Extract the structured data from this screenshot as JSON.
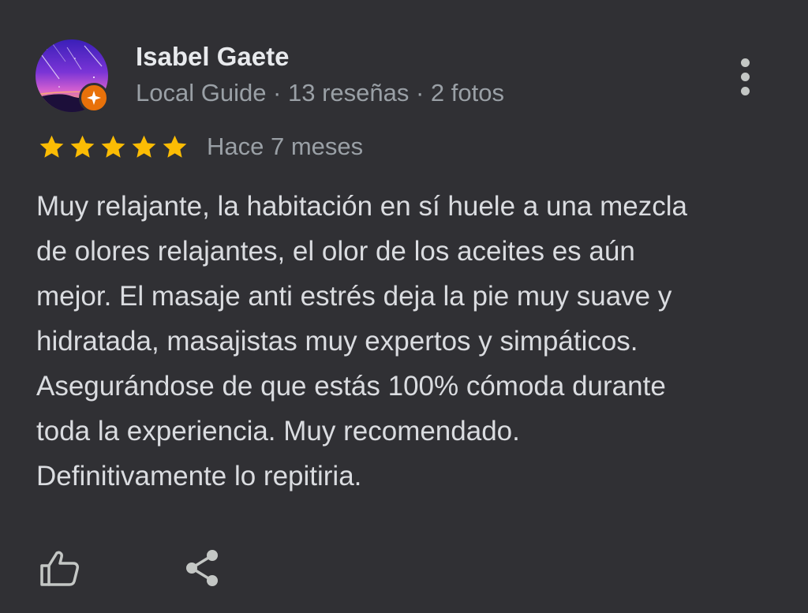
{
  "author": {
    "name": "Isabel Gaete",
    "meta": "Local Guide · 13 reseñas · 2 fotos",
    "avatar_icon": "avatar-purple-sky",
    "badge_icon": "local-guide-star-icon",
    "badge_color": "#e8710a"
  },
  "rating": {
    "stars": 5,
    "max_stars": 5,
    "star_color": "#fbbc04",
    "date": "Hace 7 meses"
  },
  "review": {
    "lines": [
      "Muy relajante, la habitación en sí huele a una mezcla",
      "de olores relajantes, el olor de los aceites es aún",
      "mejor. El masaje anti estrés deja la pie muy suave y",
      "hidratada, masajistas muy expertos y simpáticos.",
      "Asegurándose de que estás 100% cómoda durante",
      "toda la experiencia. Muy recomendado.",
      "Definitivamente lo repitiria."
    ]
  },
  "actions": {
    "like_icon": "thumbs-up-icon",
    "share_icon": "share-icon",
    "more_icon": "more-vert-icon"
  },
  "colors": {
    "background": "#303034",
    "primary_text": "#e8eaed",
    "secondary_text": "#9aa0a6",
    "body_text": "#dadce0"
  }
}
